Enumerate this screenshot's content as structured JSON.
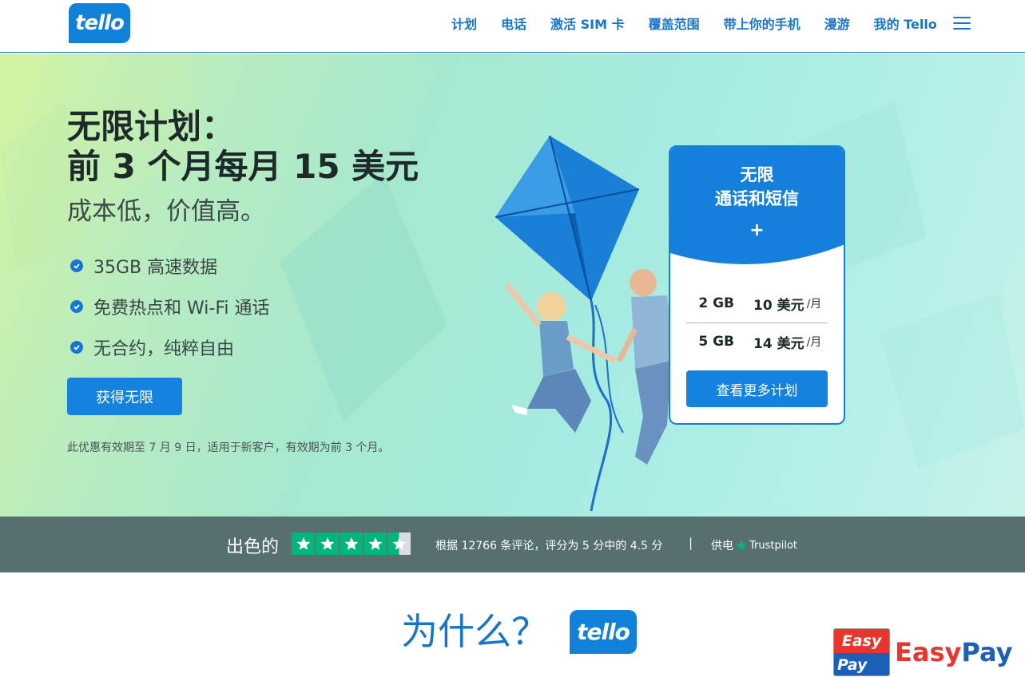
{
  "header": {
    "logo_text": "tello",
    "nav": [
      "计划",
      "电话",
      "激活 SIM 卡",
      "覆盖范围",
      "带上你的手机",
      "漫游",
      "我的 Tello"
    ]
  },
  "hero": {
    "title_line1": "无限计划：",
    "title_line2": "前 3 个月每月 15 美元",
    "subtitle": "成本低，价值高。",
    "bullets": [
      "35GB 高速数据",
      "免费热点和 Wi-Fi 通话",
      "无合约，纯粹自由"
    ],
    "cta_label": "获得无限",
    "disclaimer": "此优惠有效期至 7 月 9 日，适用于新客户，有效期为前 3 个月。"
  },
  "plan_card": {
    "heading_line1": "无限",
    "heading_line2": "通话和短信",
    "plus": "+",
    "plans": [
      {
        "data": "2 GB",
        "price": "10 美元",
        "per": "/月"
      },
      {
        "data": "5 GB",
        "price": "14 美元",
        "per": "/月"
      }
    ],
    "button_label": "查看更多计划"
  },
  "trust": {
    "rating_word": "出色的",
    "rating": 4.5,
    "review_text": "根据 12766 条评论，评分为 5 分中的 4.5 分",
    "separator": "|",
    "provided_by": "供电",
    "provider": "Trustpilot",
    "star_color": "#00b67a"
  },
  "why": {
    "heading": "为什么？",
    "logo_text": "tello"
  },
  "watermark": {
    "box_top": "Easy",
    "box_bottom": "Pay",
    "text_part1": "Easy",
    "text_part2": "Pay"
  },
  "colors": {
    "brand_blue": "#1580dc",
    "trust_bar": "#566f6f"
  }
}
